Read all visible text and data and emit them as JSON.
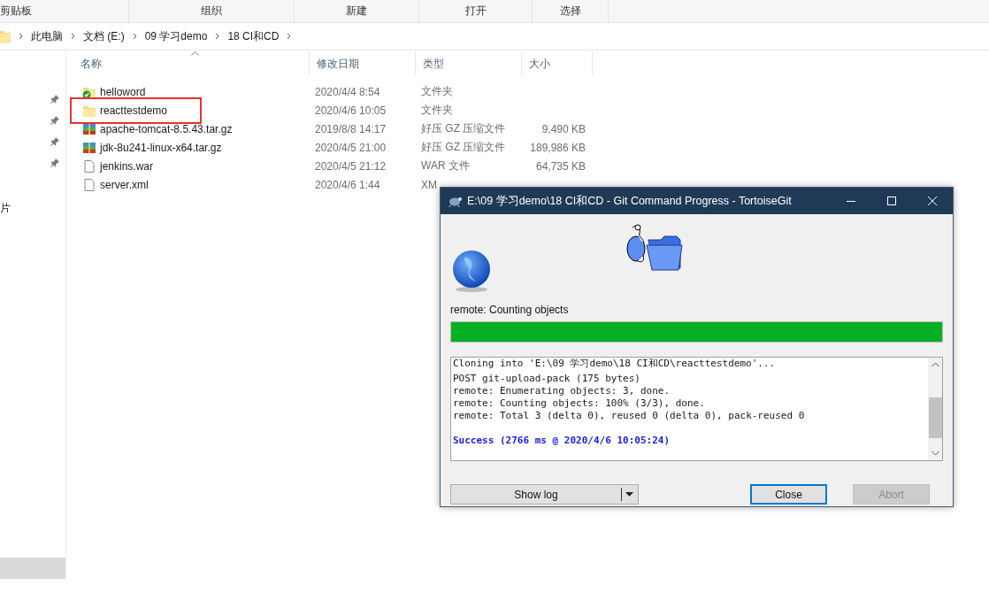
{
  "ribbon_groups": [
    "剪贴板",
    "组织",
    "新建",
    "打开",
    "选择"
  ],
  "breadcrumb": [
    "此电脑",
    "文档 (E:)",
    "09 学习demo",
    "18 CI和CD"
  ],
  "sidebar": {
    "pinned_items": [
      {
        "pinned": true
      },
      {
        "pinned": true
      },
      {
        "pinned": true
      },
      {
        "pinned": true
      }
    ],
    "nav_items": [
      {
        "label": "片",
        "selected": false
      },
      {
        "selected": true
      }
    ]
  },
  "file_list": {
    "columns": [
      "名称",
      "修改日期",
      "类型",
      "大小"
    ],
    "rows": [
      {
        "kind": "folder-synced",
        "name": "helloword",
        "modified": "2020/4/4 8:54",
        "type": "文件夹",
        "highlighted": false
      },
      {
        "kind": "folder",
        "name": "reacttestdemo",
        "modified": "2020/4/6 10:05",
        "type": "文件夹",
        "highlighted": true
      },
      {
        "kind": "archive",
        "name": "apache-tomcat-8.5.43.tar.gz",
        "modified": "2019/8/8 14:17",
        "type": "好压 GZ 压缩文件",
        "size": "9,490 KB",
        "highlighted": false
      },
      {
        "kind": "archive",
        "name": "jdk-8u241-linux-x64.tar.gz",
        "modified": "2020/4/5 21:00",
        "type": "好压 GZ 压缩文件",
        "size": "189,986 KB",
        "highlighted": false
      },
      {
        "kind": "file",
        "name": "jenkins.war",
        "modified": "2020/4/5 21:12",
        "type": "WAR 文件",
        "size": "64,735 KB",
        "highlighted": false
      },
      {
        "kind": "file",
        "name": "server.xml",
        "modified": "2020/4/6 1:44",
        "type": "XM",
        "highlighted": false
      }
    ]
  },
  "dialog": {
    "title": "E:\\09 学习demo\\18 CI和CD - Git Command Progress - TortoiseGit",
    "status": "remote: Counting objects",
    "progress": {
      "level": 1.0
    },
    "log": [
      {
        "kind": "normal",
        "text": "Cloning into 'E:\\09 学习demo\\18 CI和CD\\reacttestdemo'..."
      },
      {
        "kind": "normal",
        "text": "POST git-upload-pack (175 bytes)"
      },
      {
        "kind": "normal",
        "text": "remote: Enumerating objects: 3, done."
      },
      {
        "kind": "normal",
        "text": "remote: Counting objects: 100% (3/3), done."
      },
      {
        "kind": "normal",
        "text": "remote: Total 3 (delta 0), reused 0 (delta 0), pack-reused 0"
      },
      {
        "kind": "blank"
      },
      {
        "kind": "success",
        "text": "Success (2766 ms @ 2020/4/6 10:05:24)"
      }
    ],
    "buttons": [
      {
        "kind": "split",
        "label": "Show log",
        "default": false,
        "disabled": false
      },
      {
        "kind": "plain",
        "label": "Close",
        "default": true,
        "disabled": false
      },
      {
        "kind": "plain",
        "label": "Abort",
        "default": false,
        "disabled": true
      }
    ]
  }
}
